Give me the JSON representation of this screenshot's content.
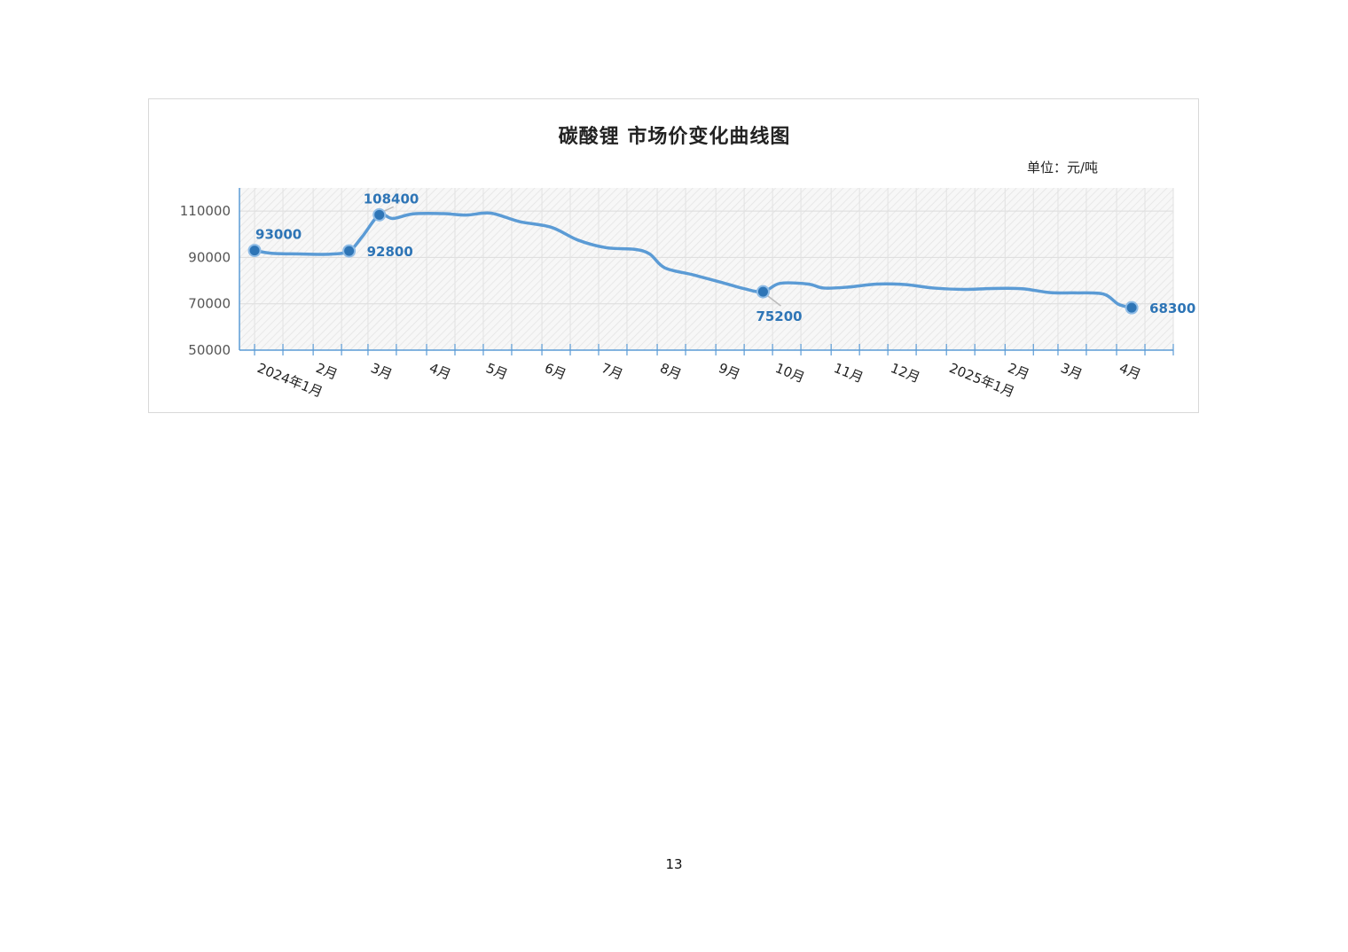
{
  "page": {
    "number": "13"
  },
  "chart_data": {
    "type": "line",
    "title": "碳酸锂 市场价变化曲线图",
    "unit_label": "单位：元/吨",
    "xlabel": "",
    "ylabel": "",
    "ylim": [
      50000,
      120000
    ],
    "yticks": [
      50000,
      70000,
      90000,
      110000
    ],
    "ytick_labels": [
      "50000",
      "70000",
      "90000",
      "110000"
    ],
    "x_range": [
      "2023-12-24",
      "2025-05-01"
    ],
    "xticks": [
      {
        "label": "2024年1月",
        "date": "2024-01-01"
      },
      {
        "label": "2月",
        "date": "2024-02-01"
      },
      {
        "label": "3月",
        "date": "2024-03-01"
      },
      {
        "label": "4月",
        "date": "2024-04-01"
      },
      {
        "label": "5月",
        "date": "2024-05-01"
      },
      {
        "label": "6月",
        "date": "2024-06-01"
      },
      {
        "label": "7月",
        "date": "2024-07-01"
      },
      {
        "label": "8月",
        "date": "2024-08-01"
      },
      {
        "label": "9月",
        "date": "2024-09-01"
      },
      {
        "label": "10月",
        "date": "2024-10-01"
      },
      {
        "label": "11月",
        "date": "2024-11-01"
      },
      {
        "label": "12月",
        "date": "2024-12-01"
      },
      {
        "label": "2025年1月",
        "date": "2025-01-01"
      },
      {
        "label": "2月",
        "date": "2025-02-01"
      },
      {
        "label": "3月",
        "date": "2025-03-01"
      },
      {
        "label": "4月",
        "date": "2025-04-01"
      }
    ],
    "grid": true,
    "colors": {
      "line": "#5b9bd5",
      "marker": "#2e75b6",
      "annotation": "#2e75b6",
      "axis": "#5b9bd5"
    },
    "series": [
      {
        "points": [
          {
            "x": "2024-01-01",
            "y": 93000
          },
          {
            "x": "2024-01-10",
            "y": 91800
          },
          {
            "x": "2024-01-25",
            "y": 91500
          },
          {
            "x": "2024-02-10",
            "y": 91400
          },
          {
            "x": "2024-02-20",
            "y": 92800
          },
          {
            "x": "2024-02-27",
            "y": 99000
          },
          {
            "x": "2024-03-07",
            "y": 108400
          },
          {
            "x": "2024-03-14",
            "y": 106800
          },
          {
            "x": "2024-03-25",
            "y": 108800
          },
          {
            "x": "2024-04-10",
            "y": 108900
          },
          {
            "x": "2024-04-22",
            "y": 108300
          },
          {
            "x": "2024-05-05",
            "y": 109100
          },
          {
            "x": "2024-05-20",
            "y": 105500
          },
          {
            "x": "2024-06-06",
            "y": 103000
          },
          {
            "x": "2024-06-20",
            "y": 97500
          },
          {
            "x": "2024-07-05",
            "y": 94200
          },
          {
            "x": "2024-07-20",
            "y": 93500
          },
          {
            "x": "2024-07-28",
            "y": 91500
          },
          {
            "x": "2024-08-05",
            "y": 85500
          },
          {
            "x": "2024-08-20",
            "y": 82500
          },
          {
            "x": "2024-09-05",
            "y": 79000
          },
          {
            "x": "2024-09-16",
            "y": 76500
          },
          {
            "x": "2024-09-26",
            "y": 75200
          },
          {
            "x": "2024-10-05",
            "y": 78800
          },
          {
            "x": "2024-10-20",
            "y": 78500
          },
          {
            "x": "2024-10-28",
            "y": 76800
          },
          {
            "x": "2024-11-10",
            "y": 77200
          },
          {
            "x": "2024-11-25",
            "y": 78500
          },
          {
            "x": "2024-12-10",
            "y": 78300
          },
          {
            "x": "2024-12-25",
            "y": 76800
          },
          {
            "x": "2025-01-10",
            "y": 76200
          },
          {
            "x": "2025-01-25",
            "y": 76600
          },
          {
            "x": "2025-02-10",
            "y": 76500
          },
          {
            "x": "2025-02-25",
            "y": 74800
          },
          {
            "x": "2025-03-10",
            "y": 74700
          },
          {
            "x": "2025-03-25",
            "y": 74200
          },
          {
            "x": "2025-04-02",
            "y": 69800
          },
          {
            "x": "2025-04-09",
            "y": 68300
          }
        ]
      }
    ],
    "annotations": [
      {
        "x": "2024-01-01",
        "y": 93000,
        "label": "93000",
        "position": "above"
      },
      {
        "x": "2024-02-20",
        "y": 92800,
        "label": "92800",
        "position": "right"
      },
      {
        "x": "2024-03-07",
        "y": 108400,
        "label": "108400",
        "position": "above"
      },
      {
        "x": "2024-09-26",
        "y": 75200,
        "label": "75200",
        "position": "below"
      },
      {
        "x": "2025-04-09",
        "y": 68300,
        "label": "68300",
        "position": "right"
      }
    ]
  }
}
